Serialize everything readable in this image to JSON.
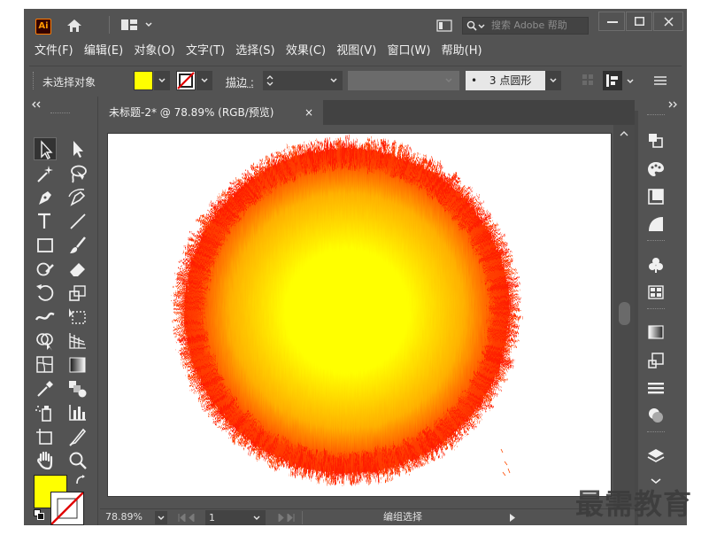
{
  "app": {
    "logo_text": "Ai",
    "search_placeholder": "搜索 Adobe 帮助"
  },
  "menu": [
    "文件(F)",
    "编辑(E)",
    "对象(O)",
    "文字(T)",
    "选择(S)",
    "效果(C)",
    "视图(V)",
    "窗口(W)",
    "帮助(H)"
  ],
  "control": {
    "selection_label": "未选择对象",
    "fill_color": "#ffff00",
    "stroke_label": "描边 :",
    "brush_label": "3 点圆形",
    "brush_bullet": "•"
  },
  "document": {
    "tab_title": "未标题-2* @ 78.89% (RGB/预览)",
    "close_glyph": "×"
  },
  "artwork": {
    "center_color": "#ffff00",
    "mid_color": "#ffb000",
    "edge_color": "#ff1e00"
  },
  "status": {
    "zoom": "78.89%",
    "artboard_number": "1",
    "tool_hint": "编组选择"
  },
  "watermark": "最需教育"
}
